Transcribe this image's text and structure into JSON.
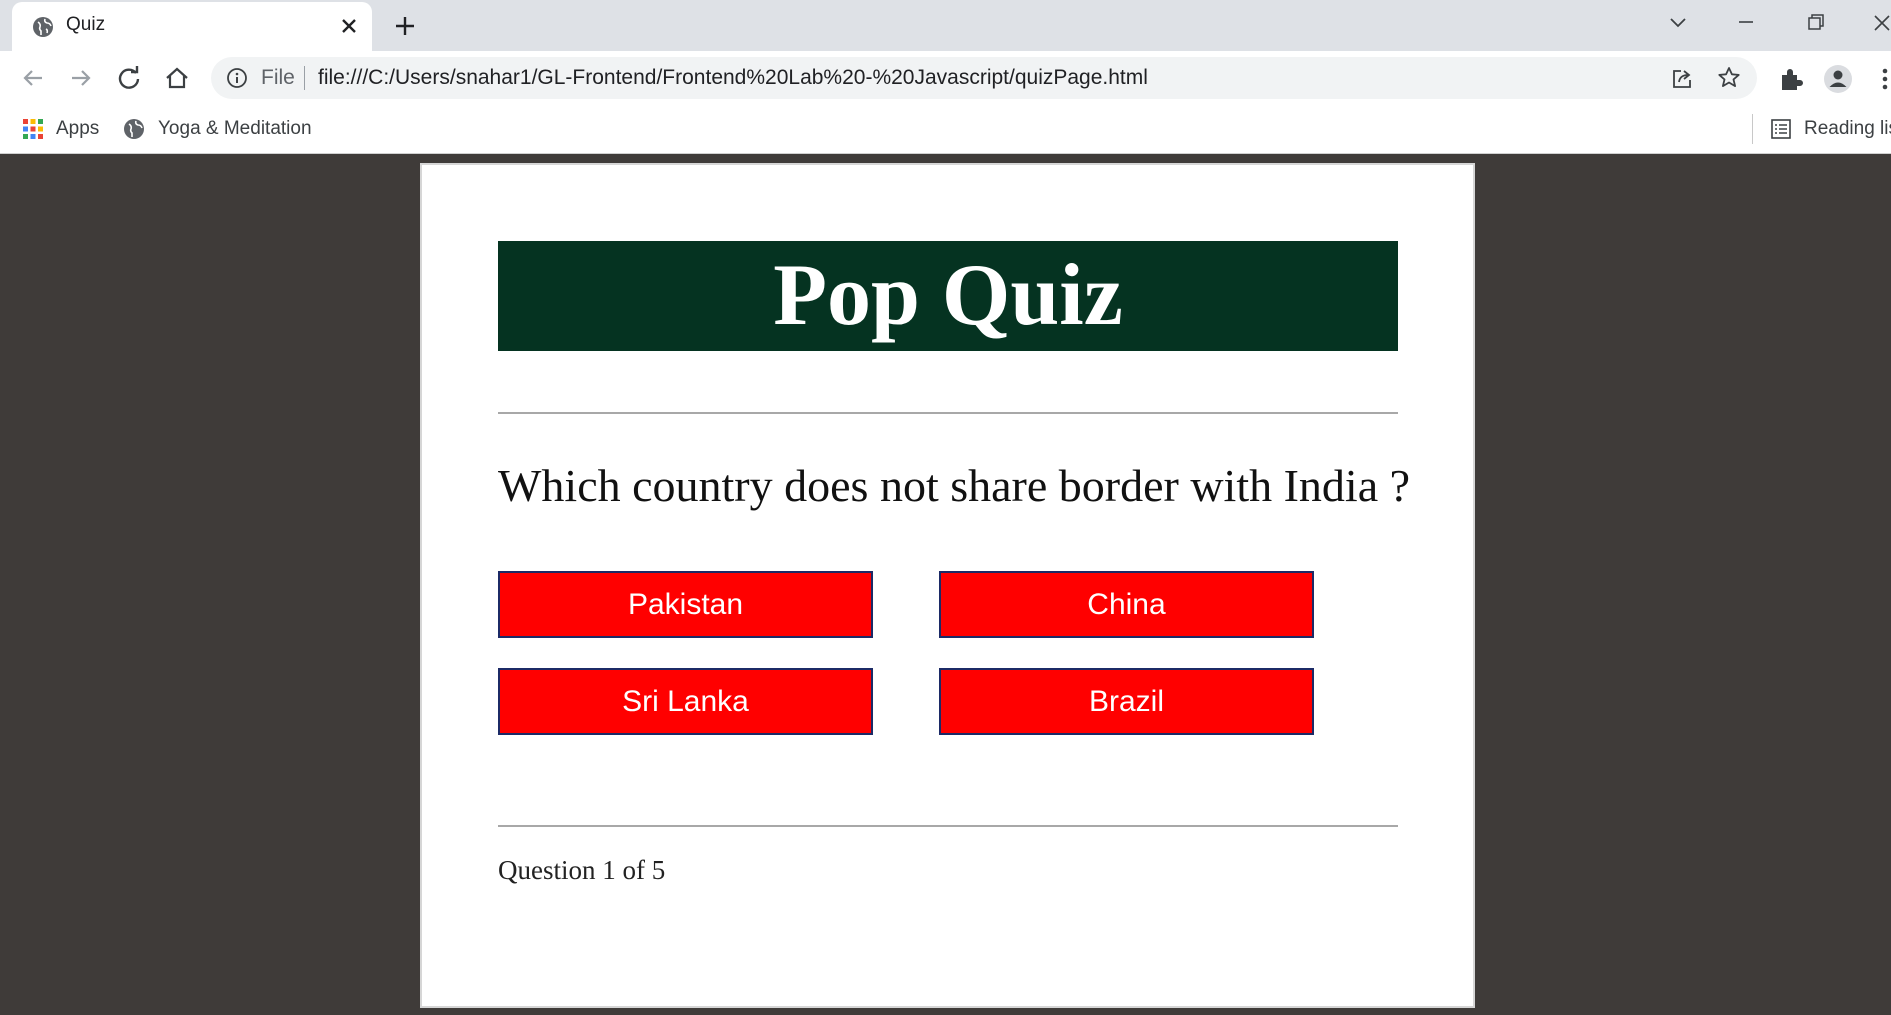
{
  "browser": {
    "tab": {
      "title": "Quiz",
      "favicon": "globe-icon"
    },
    "address": {
      "scheme": "File",
      "url": "file:///C:/Users/snahar1/GL-Frontend/Frontend%20Lab%20-%20Javascript/quizPage.html"
    },
    "bookmarks": [
      {
        "label": "Apps",
        "icon": "apps-grid-icon"
      },
      {
        "label": "Yoga & Meditation",
        "icon": "globe-icon"
      }
    ],
    "reading_list": {
      "label": "Reading lis",
      "icon": "reading-list-icon"
    }
  },
  "quiz": {
    "title": "Pop Quiz",
    "question": "Which country does not share border with India ?",
    "answers": [
      "Pakistan",
      "China",
      "Sri Lanka",
      "Brazil"
    ],
    "progress": "Question 1 of 5",
    "colors": {
      "banner": "#053321",
      "answer_bg": "#ff0000",
      "answer_border": "#1c2a66",
      "page_bg": "#3f3b39"
    }
  }
}
